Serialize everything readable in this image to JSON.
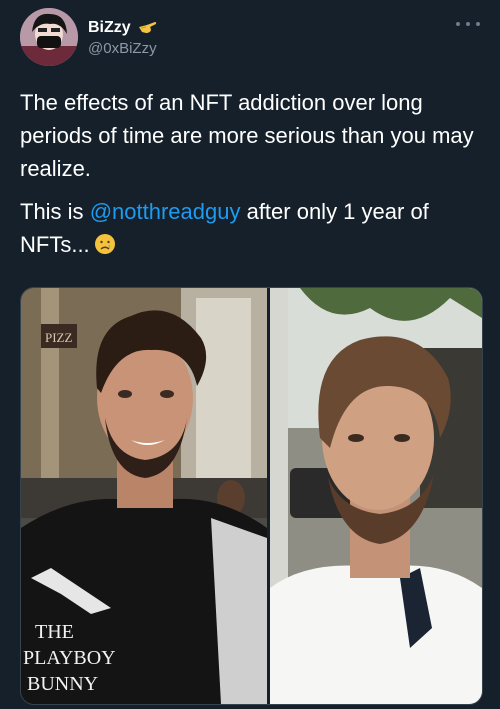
{
  "user": {
    "display_name": "BiZzy",
    "name_emoji": "pointing-hand-emoji",
    "handle": "@0xBiZzy"
  },
  "tweet": {
    "line1": "The effects of an NFT addiction over long periods of time are more serious than you may realize.",
    "line2_prefix": "This is ",
    "mention": "@notthreadguy",
    "line2_suffix": " after only 1 year of NFTs...",
    "end_emoji": "crying-face-emoji"
  },
  "media": {
    "left_photo": {
      "sign_text": "PIZZ",
      "shirt_text": [
        "THE",
        "PLAYBOY",
        "BUNNY"
      ]
    },
    "right_photo": {}
  },
  "colors": {
    "background": "#15202b",
    "text": "#ffffff",
    "secondary_text": "#8b98a5",
    "link": "#1d9bf0"
  }
}
